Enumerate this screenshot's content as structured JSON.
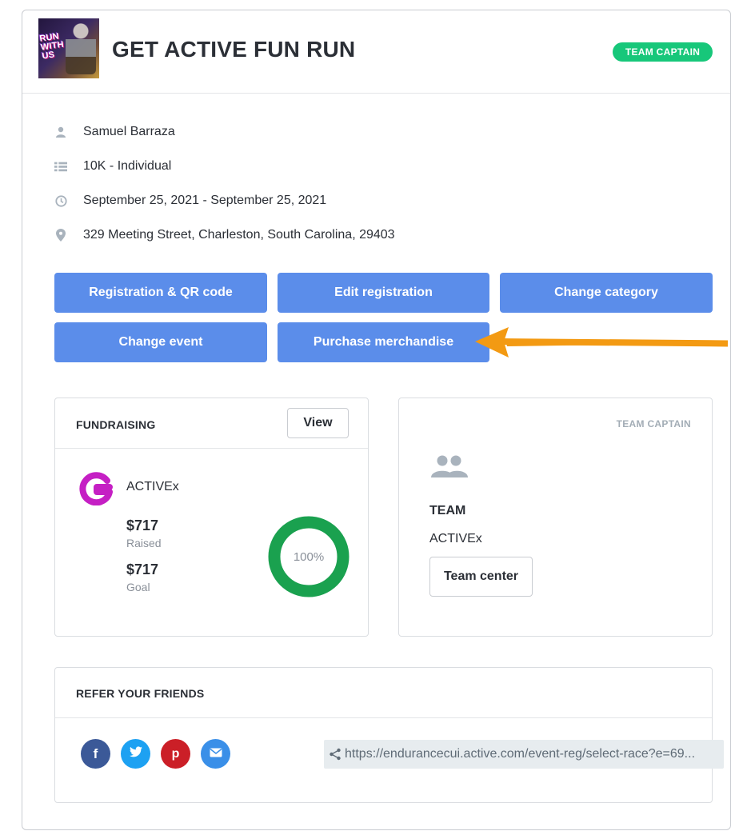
{
  "event": {
    "title": "GET ACTIVE FUN RUN",
    "thumbnail_text": "RUN WITH US",
    "role_badge": "TEAM CAPTAIN"
  },
  "details": {
    "participant": "Samuel Barraza",
    "category": "10K - Individual",
    "dates": "September 25, 2021 - September 25, 2021",
    "address": "329 Meeting Street, Charleston, South Carolina, 29403"
  },
  "actions": {
    "registration_qr": "Registration & QR code",
    "edit_registration": "Edit registration",
    "change_category": "Change category",
    "change_event": "Change event",
    "purchase_merchandise": "Purchase merchandise"
  },
  "fundraising": {
    "title": "FUNDRAISING",
    "view_label": "View",
    "org_name": "ACTIVEx",
    "raised_amount": "$717",
    "raised_label": "Raised",
    "goal_amount": "$717",
    "goal_label": "Goal",
    "progress_label": "100%",
    "progress_fraction": 1.0
  },
  "team": {
    "role_label": "TEAM CAPTAIN",
    "heading": "TEAM",
    "name": "ACTIVEx",
    "team_center_label": "Team center"
  },
  "refer": {
    "title": "REFER YOUR FRIENDS",
    "share_url": "https://endurancecui.active.com/event-reg/select-race?e=69..."
  },
  "colors": {
    "primary_button": "#5b8dea",
    "badge_green": "#17c77a",
    "progress_green": "#1aa14f",
    "facebook": "#3b5998",
    "twitter": "#1da1f2",
    "pinterest": "#cb1f27",
    "email": "#3a8fe8",
    "annotation_arrow": "#f39a13"
  }
}
